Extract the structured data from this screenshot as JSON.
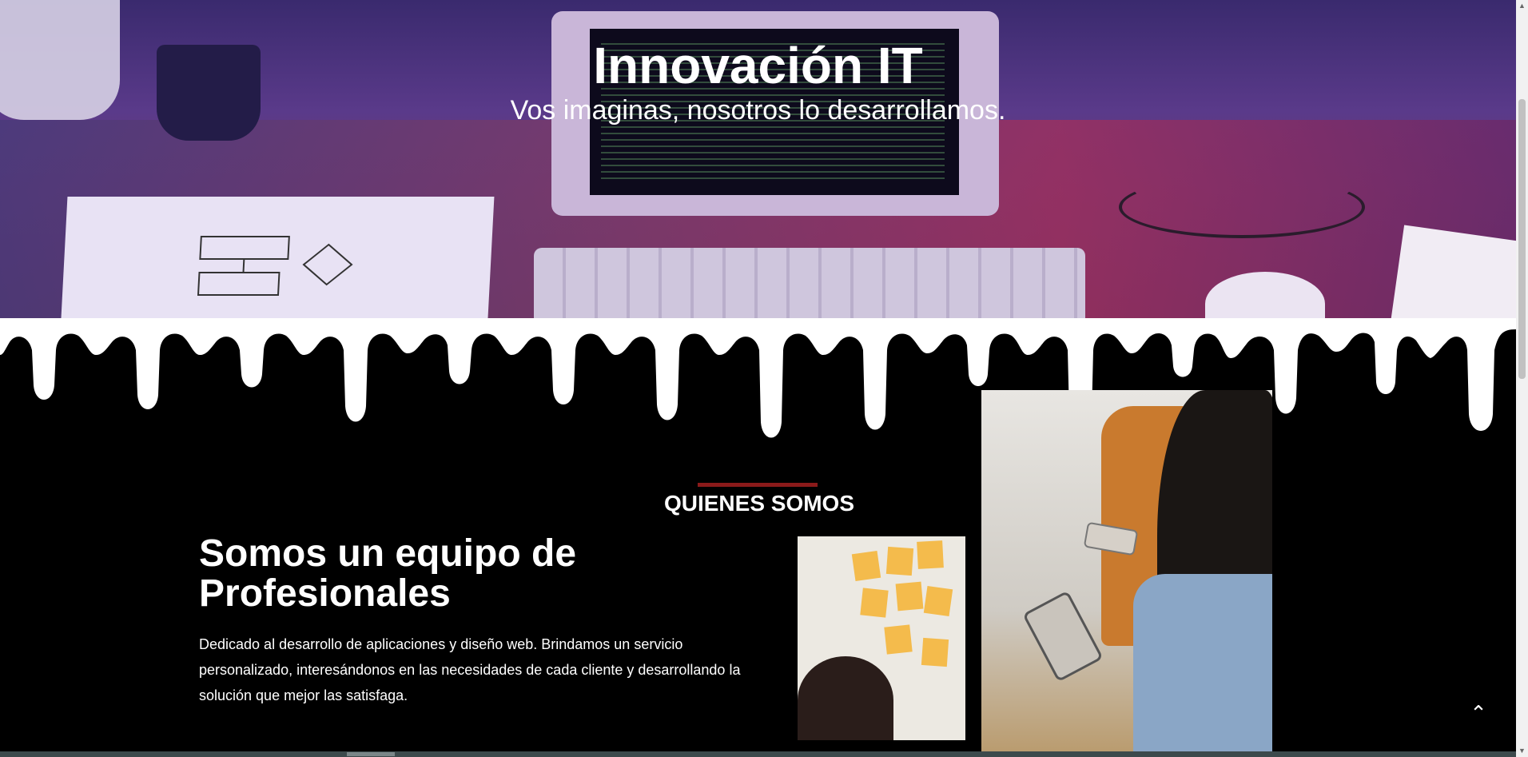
{
  "hero": {
    "title": "Innovación IT",
    "subtitle": "Vos imaginas, nosotros lo desarrollamos."
  },
  "about": {
    "section_label": "QUIENES SOMOS",
    "heading": "Somos un equipo de Profesionales",
    "description": "Dedicado al desarrollo de aplicaciones y diseño web. Brindamos un servicio personalizado, interesándonos en las necesidades de cada cliente y desarrollando la solución que mejor las satisfaga."
  },
  "controls": {
    "back_to_top_icon": "chevron-up-icon",
    "back_to_top_glyph": "⌃"
  },
  "colors": {
    "accent": "#8b1a1a",
    "background": "#000000",
    "text": "#ffffff"
  }
}
